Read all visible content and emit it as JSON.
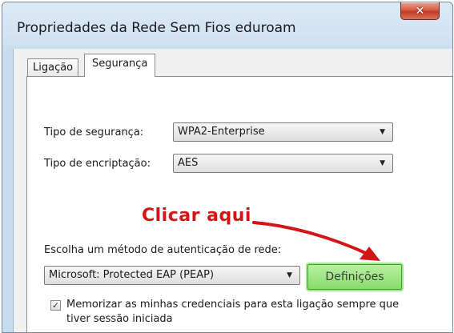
{
  "window": {
    "title": "Propriedades da Rede Sem Fios eduroam",
    "close_icon": "close-icon",
    "close_glyph": "✕"
  },
  "tabs": [
    {
      "label": "Ligação",
      "selected": false
    },
    {
      "label": "Segurança",
      "selected": true
    }
  ],
  "security": {
    "type_label": "Tipo de segurança:",
    "type_value": "WPA2-Enterprise",
    "encryption_label": "Tipo de encriptação:",
    "encryption_value": "AES",
    "auth_label": "Escolha um método de autenticação de rede:",
    "auth_value": "Microsoft: Protected EAP (PEAP)",
    "settings_button": "Definições",
    "remember_checked": true,
    "remember_label": "Memorizar as minhas credenciais para esta ligação sempre que tiver sessão iniciada"
  },
  "annotation": {
    "text": "Clicar aqui",
    "color": "#d41515"
  },
  "colors": {
    "highlight_button": "#87dc6a",
    "annotation_arrow": "#d41515"
  }
}
